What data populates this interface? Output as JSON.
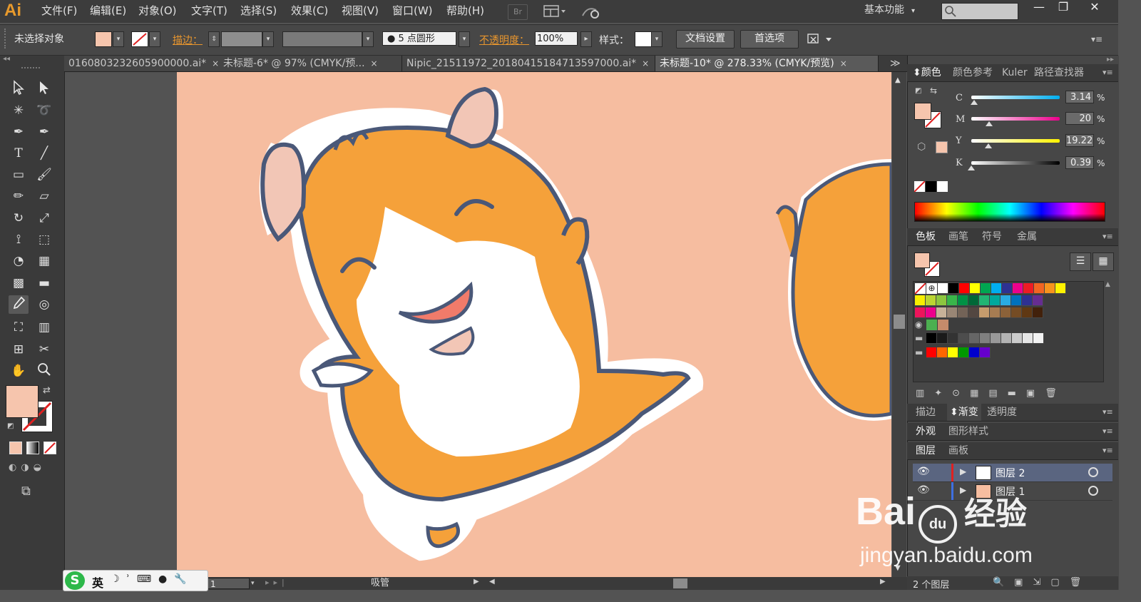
{
  "app": {
    "logo": "Ai",
    "brand_color": "#e89a2c"
  },
  "menu": [
    "文件(F)",
    "编辑(E)",
    "对象(O)",
    "文字(T)",
    "选择(S)",
    "效果(C)",
    "视图(V)",
    "窗口(W)",
    "帮助(H)"
  ],
  "menu_extras": {
    "bridge": "Br",
    "arrange_icon": "arrange-documents-icon",
    "gpu_icon": "gpu-performance-icon"
  },
  "workspace": {
    "label": "基本功能",
    "arrow": "▾"
  },
  "search": {
    "placeholder": ""
  },
  "window_controls": {
    "minimize": "—",
    "restore": "❐",
    "close": "✕"
  },
  "control": {
    "selection": "未选择对象",
    "stroke_label": "描边：",
    "brush_label": "● 5 点圆形",
    "opacity_label": "不透明度：",
    "opacity_value": "100%",
    "style_label": "样式：",
    "doc_setup": "文档设置",
    "preferences": "首选项",
    "fill_color": "#f6c5ad"
  },
  "tabs": [
    {
      "label": "0160803232605900000.ai*",
      "close": "×"
    },
    {
      "label": "未标题-6* @ 97% (CMYK/预...",
      "close": "×"
    },
    {
      "label": "Nipic_21511972_20180415184713597000.ai*",
      "close": "×"
    },
    {
      "label": "未标题-10* @ 278.33% (CMYK/预览)",
      "close": "×"
    }
  ],
  "tab_overflow": "≫",
  "status": {
    "zoom": "1",
    "tool": "吸管"
  },
  "color_panel": {
    "tabs": [
      "颜色",
      "颜色参考",
      "Kuler",
      "路径查找器"
    ],
    "channels": [
      {
        "name": "C",
        "value": "3.14",
        "unit": "%",
        "level": 0.03
      },
      {
        "name": "M",
        "value": "20",
        "unit": "%",
        "level": 0.2
      },
      {
        "name": "Y",
        "value": "19.22",
        "unit": "%",
        "level": 0.19
      },
      {
        "name": "K",
        "value": "0.39",
        "unit": "%",
        "level": 0.004
      }
    ]
  },
  "swatches_panel": {
    "tabs": [
      "色板",
      "画笔",
      "符号",
      "金属"
    ],
    "rows": [
      [
        "#ffffff",
        "#000000",
        "#ff0000",
        "#ffff00",
        "#00a651",
        "#00aeef",
        "#2e3192",
        "#ec008c",
        "#ed1c24",
        "#f26522",
        "#f7941d",
        "#fff200"
      ],
      [
        "#f7ef00",
        "#bbd532",
        "#8dc63f",
        "#39b54a",
        "#009245",
        "#006837",
        "#22b573",
        "#00a99d",
        "#29abe2",
        "#0071bc",
        "#2e3192",
        "#662d91"
      ],
      [
        "#ed145b",
        "#ec008c",
        "#c7b299",
        "#998675",
        "#736357",
        "#534741",
        "#c69c6d",
        "#a67c52",
        "#8c6239",
        "#754c24",
        "#603813",
        "#42210b"
      ],
      [
        "#000000",
        "#1a1a1a",
        "#333333",
        "#4d4d4d",
        "#666666",
        "#808080",
        "#999999",
        "#b3b3b3",
        "#cccccc",
        "#e6e6e6",
        "#f2f2f2"
      ],
      [
        "#ff0000",
        "#ff6600",
        "#ffff00",
        "#009900",
        "#0000cc",
        "#6600cc"
      ]
    ]
  },
  "collapsed_panels": [
    {
      "tabs": [
        "描边",
        "渐变",
        "透明度"
      ],
      "active": 1
    },
    {
      "tabs": [
        "外观",
        "图形样式"
      ],
      "active": 0
    }
  ],
  "layers_panel": {
    "tabs": [
      "图层",
      "画板"
    ],
    "layers": [
      {
        "name": "图层 2"
      },
      {
        "name": "图层 1"
      }
    ],
    "count": "2 个图层"
  },
  "watermark": {
    "brand": "Bai",
    "paw": "du",
    "cn": "经验",
    "url": "jingyan.baidu.com"
  },
  "ime": {
    "lang": "英"
  }
}
